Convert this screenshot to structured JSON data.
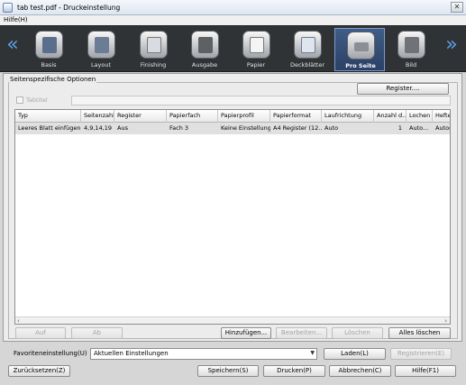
{
  "window": {
    "title": "tab test.pdf - Druckeinstellung",
    "app_icon": "printer-document-icon",
    "close_icon": "close-icon"
  },
  "menu": {
    "help": "Hilfe(H)"
  },
  "nav": {
    "left_icon": "double-chevron-left-icon",
    "right_icon": "double-chevron-right-icon"
  },
  "tabs": [
    {
      "label": "Basis",
      "icon": "basic-settings-icon"
    },
    {
      "label": "Layout",
      "icon": "layout-icon"
    },
    {
      "label": "Finishing",
      "icon": "finishing-icon"
    },
    {
      "label": "Ausgabe",
      "icon": "output-icon"
    },
    {
      "label": "Papier",
      "icon": "paper-icon"
    },
    {
      "label": "Deckblätter",
      "icon": "cover-sheet-icon"
    },
    {
      "label": "Pro Seite",
      "icon": "per-page-icon",
      "active": true
    },
    {
      "label": "Bild",
      "icon": "image-icon"
    }
  ],
  "panel": {
    "group_title": "Seitenspezifische Optionen",
    "register_button": "Register....",
    "tab_checkbox_label": "Tabtitel",
    "table": {
      "columns": [
        "Typ",
        "Seitenzahl",
        "Register",
        "Papierfach",
        "Papierprofil",
        "Papierformat",
        "Laufrichtung",
        "Anzahl d...",
        "Lochen",
        "Heften"
      ],
      "rows": [
        [
          "Leeres Blatt einfügen ...",
          "4,9,14,19",
          "Aus",
          "Fach 3",
          "Keine Einstellung",
          "A4 Register (12....",
          "Auto",
          "1",
          "Auto...",
          "Autom"
        ]
      ]
    },
    "buttons": {
      "up": "Auf",
      "down": "Ab",
      "add": "Hinzufügen...",
      "edit": "Bearbeiten...",
      "delete": "Löschen",
      "delete_all": "Alles löschen"
    }
  },
  "favorites": {
    "label": "Favoriteneinstellung(U)",
    "selected": "Aktuellen Einstellungen",
    "load": "Laden(L)",
    "register": "Registrieren(E)"
  },
  "footer": {
    "reset": "Zurücksetzen(Z)",
    "save": "Speichern(S)",
    "print": "Drucken(P)",
    "cancel": "Abbrechen(C)",
    "help": "Hilfe(F1)"
  }
}
